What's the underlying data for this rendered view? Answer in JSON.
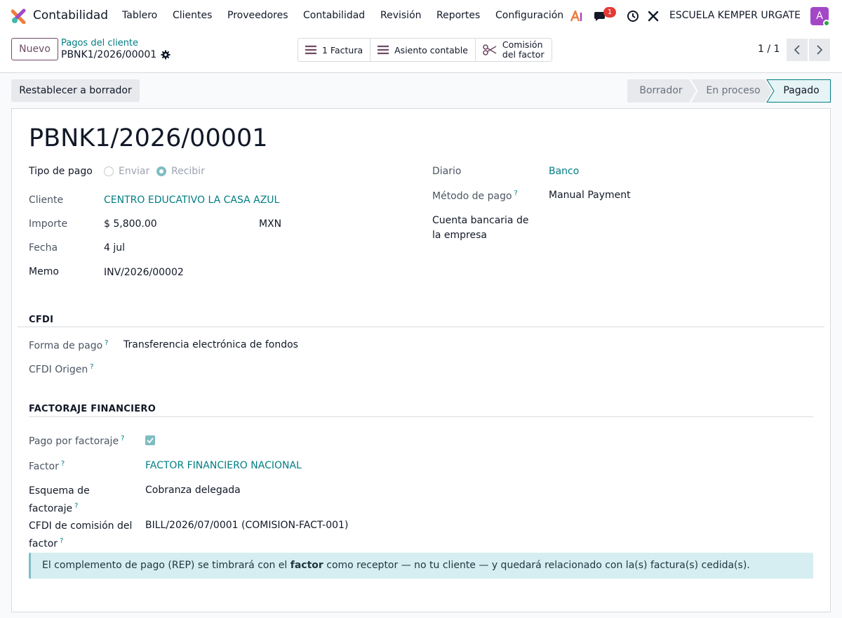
{
  "navbar": {
    "app_name": "Contabilidad",
    "menu": [
      "Tablero",
      "Clientes",
      "Proveedores",
      "Contabilidad",
      "Revisión",
      "Reportes",
      "Configuración"
    ],
    "messages_count": "1",
    "company": "ESCUELA KEMPER URGATE",
    "avatar_letter": "A"
  },
  "control": {
    "new_button": "Nuevo",
    "breadcrumb_parent": "Pagos del cliente",
    "breadcrumb_current": "PBNK1/2026/00001",
    "smart_buttons": {
      "invoice": "1 Factura",
      "journal_entry": "Asiento contable",
      "factor_fee_line1": "Comisión",
      "factor_fee_line2": "del factor"
    },
    "pager": "1 / 1"
  },
  "statusbar": {
    "reset_button": "Restablecer a borrador",
    "stages": [
      "Borrador",
      "En proceso",
      "Pagado"
    ],
    "current_stage": "Pagado"
  },
  "form": {
    "title": "PBNK1/2026/00001",
    "payment_type": {
      "label": "Tipo de pago",
      "options": [
        "Enviar",
        "Recibir"
      ],
      "selected": "Recibir"
    },
    "customer": {
      "label": "Cliente",
      "value": "CENTRO EDUCATIVO LA CASA AZUL"
    },
    "amount": {
      "label": "Importe",
      "value": "$ 5,800.00",
      "currency": "MXN"
    },
    "date": {
      "label": "Fecha",
      "value": "4 jul"
    },
    "memo": {
      "label": "Memo",
      "value": "INV/2026/00002"
    },
    "journal": {
      "label": "Diario",
      "value": "Banco"
    },
    "payment_method": {
      "label": "Método de pago",
      "value": "Manual Payment"
    },
    "company_bank_account": {
      "label_line1": "Cuenta bancaria de",
      "label_line2": "la empresa",
      "value": ""
    }
  },
  "cfdi": {
    "section_title": "CFDI",
    "payment_form": {
      "label": "Forma de pago",
      "value": "Transferencia electrónica de fondos"
    },
    "origin": {
      "label": "CFDI Origen",
      "value": ""
    }
  },
  "factoring": {
    "section_title": "FACTORAJE FINANCIERO",
    "is_factoring": {
      "label": "Pago por factoraje",
      "checked": true
    },
    "factor": {
      "label": "Factor",
      "value": "FACTOR FINANCIERO NACIONAL"
    },
    "scheme": {
      "label_line1": "Esquema de",
      "label_line2": "factoraje",
      "value": "Cobranza delegada"
    },
    "fee_cfdi": {
      "label_line1": "CFDI de comisión del",
      "label_line2": "factor",
      "value": "BILL/2026/07/0001 (COMISION-FACT-001)"
    }
  },
  "alert": {
    "before": "El complemento de pago (REP) se timbrará con el",
    "bold": "factor",
    "after": "como receptor — no tu cliente — y quedará relacionado con la(s) factura(s) cedida(s)."
  },
  "colors": {
    "brand": "#714b67",
    "link": "#017e84",
    "accent": "#7fbdc2",
    "alert_bg": "#d6eef1",
    "badge": "#e53935",
    "avatar": "#a347c7"
  },
  "icons": [
    "app-logo-icon",
    "ai-icon",
    "chat-icon",
    "clock-icon",
    "tools-icon",
    "gear-icon",
    "list-icon",
    "scissors-icon",
    "chevron-left-icon",
    "chevron-right-icon",
    "check-icon"
  ]
}
